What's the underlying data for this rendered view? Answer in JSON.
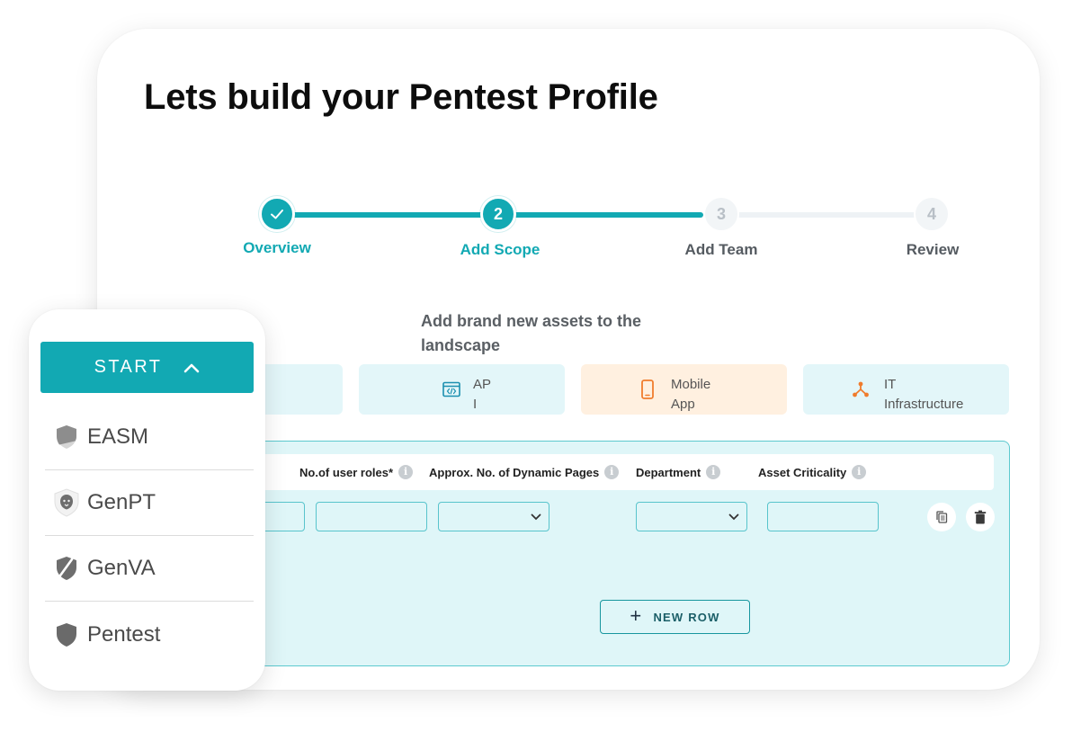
{
  "page": {
    "title": "Lets build your Pentest Profile"
  },
  "stepper": {
    "steps": [
      {
        "number": "",
        "label": "Overview",
        "state": "done"
      },
      {
        "number": "2",
        "label": "Add Scope",
        "state": "active"
      },
      {
        "number": "3",
        "label": "Add Team",
        "state": "todo"
      },
      {
        "number": "4",
        "label": "Review",
        "state": "todo"
      }
    ]
  },
  "scope": {
    "heading": "Add brand new assets to the landscape",
    "tiles": [
      {
        "label": "AP\nI",
        "icon": "api-code-icon"
      },
      {
        "label": "Mobile\nApp",
        "icon": "mobile-phone-icon"
      },
      {
        "label": "IT\nInfrastructure",
        "icon": "network-nodes-icon"
      }
    ],
    "columns": [
      {
        "label": "No.of user roles*"
      },
      {
        "label": "Approx. No. of Dynamic Pages"
      },
      {
        "label": "Department"
      },
      {
        "label": "Asset Criticality"
      }
    ],
    "info_glyph": "i",
    "new_row_label": "NEW ROW",
    "new_row_icon": "+"
  },
  "sidebar": {
    "start_label": "START",
    "items": [
      {
        "label": "EASM",
        "icon": "shield-half-icon"
      },
      {
        "label": "GenPT",
        "icon": "lion-shield-icon"
      },
      {
        "label": "GenVA",
        "icon": "shield-slash-icon"
      },
      {
        "label": "Pentest",
        "icon": "shield-icon"
      }
    ]
  },
  "colors": {
    "accent": "#12a9b3",
    "panel_bg": "#dff6f8",
    "mobile_tile_bg": "#fff0e0",
    "infra_icon": "#f07c2d"
  }
}
